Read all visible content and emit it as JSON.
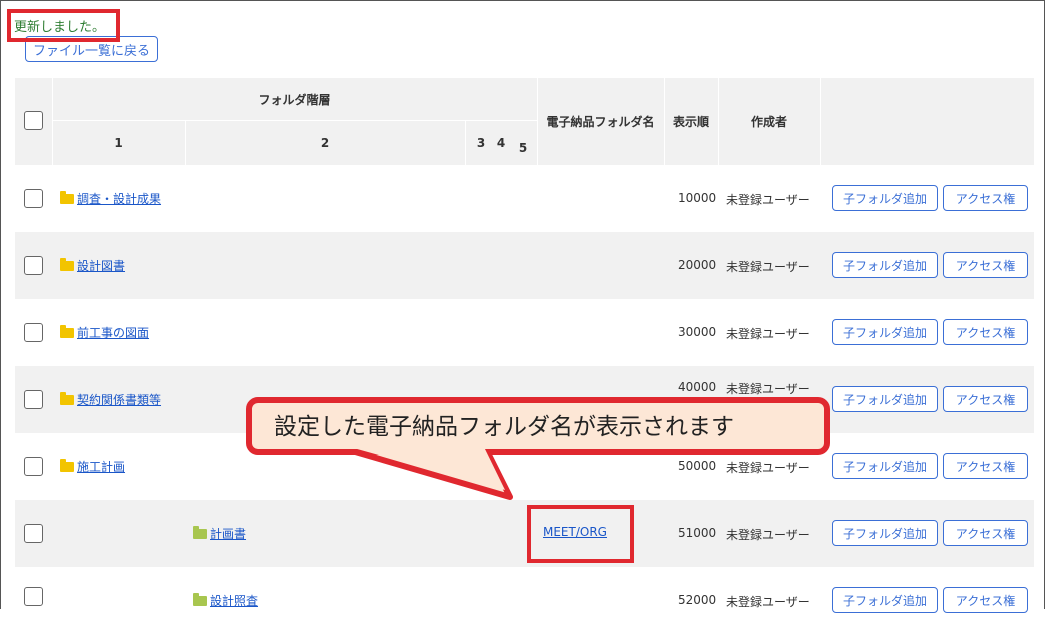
{
  "status_message": "更新しました。",
  "back_button": "ファイル一覧に戻る",
  "table": {
    "header_group": "フォルダ階層",
    "levels": [
      "1",
      "2",
      "3",
      "4",
      "5"
    ],
    "col_einvoice": "電子納品フォルダ名",
    "col_order": "表示順",
    "col_creator": "作成者"
  },
  "rows": [
    {
      "name": "調査・設計成果",
      "order": "10000",
      "creator": "未登録ユーザー"
    },
    {
      "name": "設計図書",
      "order": "20000",
      "creator": "未登録ユーザー"
    },
    {
      "name": "前工事の図面",
      "order": "30000",
      "creator": "未登録ユーザー"
    },
    {
      "name": "契約関係書類等",
      "order": "40000",
      "creator": "未登録ユーザー"
    },
    {
      "name": "施工計画",
      "order": "50000",
      "creator": "未登録ユーザー"
    },
    {
      "name": "計画書",
      "order": "51000",
      "creator": "未登録ユーザー",
      "einvoice": "MEET/ORG"
    },
    {
      "name": "設計照査",
      "order": "52000",
      "creator": "未登録ユーザー"
    }
  ],
  "row_buttons": {
    "add_subfolder": "子フォルダ追加",
    "access": "アクセス権"
  },
  "callout_text": "設定した電子納品フォルダ名が表示されます",
  "colors": {
    "accent": "#3b6fd6",
    "highlight": "#e0282f",
    "callout_bg": "#fde7d6",
    "folder": "#f2c400",
    "folder_sub": "#a8c64f"
  }
}
